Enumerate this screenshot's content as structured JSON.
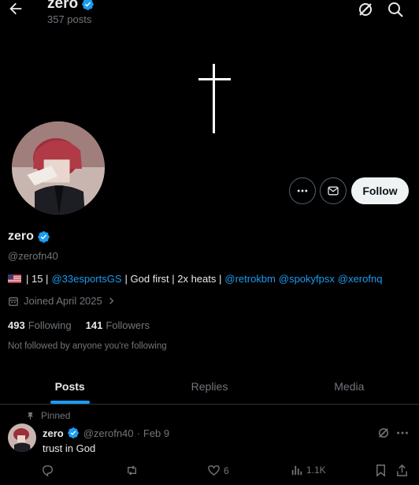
{
  "header": {
    "name": "zero",
    "posts_count": "357 posts"
  },
  "profile": {
    "name": "zero",
    "handle": "@zerofn40",
    "bio": {
      "part1": "| 15 |",
      "mention1": "@33esportsGS",
      "part2": "| God first | 2x heats |",
      "mention2": "@retrokbm",
      "mention3": "@spokyfpsx",
      "mention4": "@xerofnq"
    },
    "joined": "Joined April 2025",
    "following_count": "493",
    "following_label": "Following",
    "followers_count": "141",
    "followers_label": "Followers",
    "not_followed": "Not followed by anyone you're following",
    "follow_label": "Follow"
  },
  "tabs": [
    {
      "label": "Posts",
      "active": true
    },
    {
      "label": "Replies",
      "active": false
    },
    {
      "label": "Media",
      "active": false
    }
  ],
  "post": {
    "pinned_label": "Pinned",
    "author_name": "zero",
    "author_handle": "@zerofn40",
    "separator": "·",
    "date": "Feb 9",
    "text": "trust in God",
    "likes": "6",
    "views": "1.1K"
  },
  "colors": {
    "background": "#000000",
    "accent": "#1d9bf0",
    "muted": "#71767b",
    "text": "#e7e9ea"
  },
  "icons": [
    "back-arrow-icon",
    "verified-badge-icon",
    "grok-icon",
    "search-icon",
    "more-icon",
    "mail-icon",
    "calendar-icon",
    "chevron-right-icon",
    "pin-icon",
    "reply-icon",
    "repost-icon",
    "like-icon",
    "views-icon",
    "bookmark-icon",
    "share-icon"
  ]
}
